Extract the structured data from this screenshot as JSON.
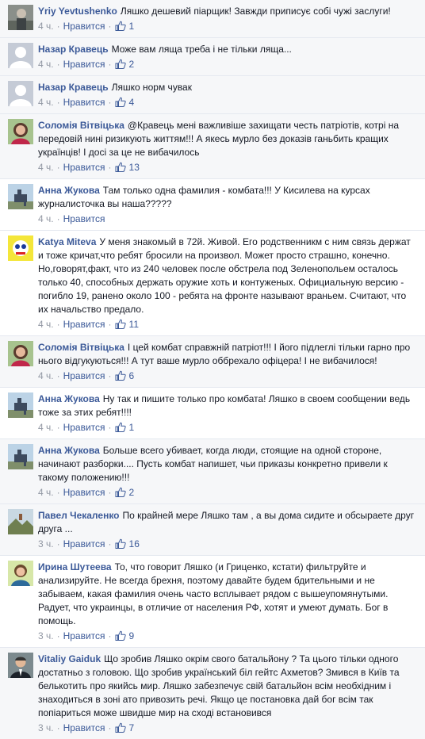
{
  "colors": {
    "link": "#3b5998",
    "meta": "#9197a3",
    "text": "#141823",
    "bg_alt": "#f6f7f9"
  },
  "icons": {
    "like": "thumbs-up-icon",
    "avatar_default": "default-avatar-icon"
  },
  "comments": [
    {
      "author": "Yriy Yevtushenko",
      "text": "Ляшко дешевий піарщик! Завжди приписує собі чужі заслуги!",
      "time": "4 ч.",
      "like_label": "Нравится",
      "likes": "1",
      "avatar": "photo-gray"
    },
    {
      "author": "Назар Кравець",
      "text": "Може вам ляща треба і не тільки ляща...",
      "time": "4 ч.",
      "like_label": "Нравится",
      "likes": "2",
      "avatar": "default"
    },
    {
      "author": "Назар Кравець",
      "text": "Ляшко норм чувак",
      "time": "4 ч.",
      "like_label": "Нравится",
      "likes": "4",
      "avatar": "default"
    },
    {
      "author": "Соломія Вітвіцька",
      "text": "@Кравець мені важливіше захищати честь патріотів, котрі на передовій нині ризикують життям!!! А якесь мурло без доказів ганьбить кращих українців! І досі за це не вибачилось",
      "time": "4 ч.",
      "like_label": "Нравится",
      "likes": "13",
      "avatar": "woman"
    },
    {
      "author": "Анна Жукова",
      "text": "Там только одна фамилия - комбата!!! У Кисилева на курсах журналисточка вы наша?????",
      "time": "4 ч.",
      "like_label": "Нравится",
      "likes": "",
      "avatar": "statue"
    },
    {
      "author": "Katya Miteva",
      "text": "У меня знакомый в 72й. Живой. Его родственникм с ним связь держат и тоже кричат,что ребят бросили на произвол. Может просто страшно, конечно. Но,говорят,факт, что из 240 человек после обстрела под Зеленопольем осталось только 40, способных держать оружие хоть и контуженых. Официальную версию - погибло 19, ранено около 100 - ребята на фронте называют враньем. Считают, что их начальство предало.",
      "time": "4 ч.",
      "like_label": "Нравится",
      "likes": "11",
      "avatar": "cartoon"
    },
    {
      "author": "Соломія Вітвіцька",
      "text": "І цей комбат справжній патріот!!! І його підлеглі тільки гарно про нього відгукуються!!! А тут ваше мурло оббрехало офіцера! І не вибачилося!",
      "time": "4 ч.",
      "like_label": "Нравится",
      "likes": "6",
      "avatar": "woman"
    },
    {
      "author": "Анна Жукова",
      "text": "Ну так и пишите только про комбата! Ляшко в своем сообщении ведь тоже за этих ребят!!!!",
      "time": "4 ч.",
      "like_label": "Нравится",
      "likes": "1",
      "avatar": "statue"
    },
    {
      "author": "Анна Жукова",
      "text": "Больше всего убивает, когда люди, стоящие на одной стороне, начинают разборки.... Пусть комбат напишет, чьи приказы конкретно привели к такому положению!!!",
      "time": "4 ч.",
      "like_label": "Нравится",
      "likes": "2",
      "avatar": "statue"
    },
    {
      "author": "Павел Чекаленко",
      "text": "По крайней мере Ляшко там , а вы дома сидите и обсыраете друг друга ...",
      "time": "3 ч.",
      "like_label": "Нравится",
      "likes": "16",
      "avatar": "landscape"
    },
    {
      "author": "Ирина Шутеева",
      "text": "То, что говорит Ляшко (и Гриценко, кстати) фильтруйте и анализируйте. Не всегда брехня, поэтому давайте будем бдительными и не забываем, какая фамилия очень часто всплывает рядом с вышеупомянутыми. Радует, что украинцы, в отличие от населения РФ, хотят и умеют думать. Бог в помощь.",
      "time": "3 ч.",
      "like_label": "Нравится",
      "likes": "9",
      "avatar": "woman2"
    },
    {
      "author": "Vitaliy Gaiduk",
      "text": "Що зробив Ляшко окрім свого батальйону ? Та цього тільки одного достатньо з головою. Що зробив український біл гейтс Ахметов? Змився в Київ та белькотить про якийсь мир. Ляшко забезпечує свій батальйон всім необхідним і знаходиться в зоні ато привозить речі. Якщо це постановка дай бог всім так попіариться може швидше мир на сході встановився",
      "time": "3 ч.",
      "like_label": "Нравится",
      "likes": "7",
      "avatar": "man"
    }
  ]
}
